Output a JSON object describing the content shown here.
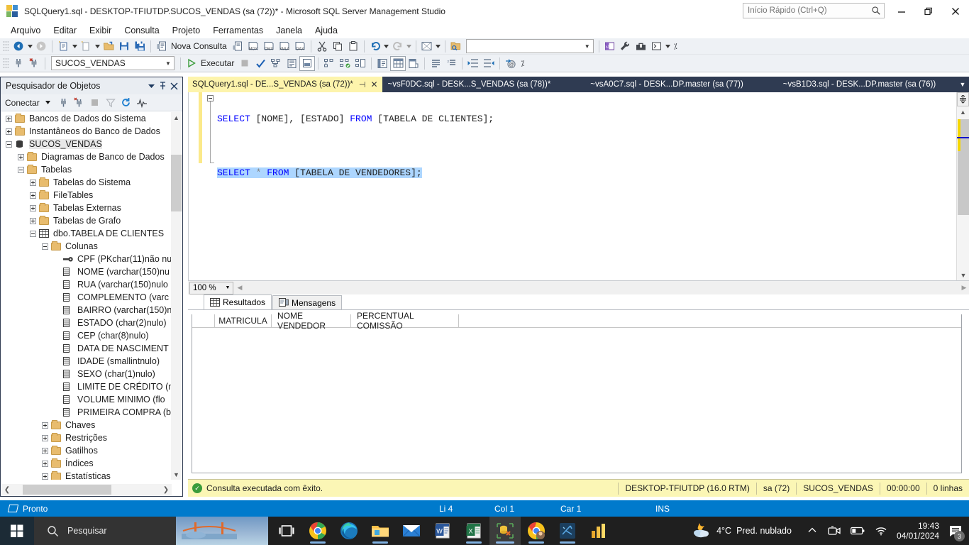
{
  "window": {
    "title": "SQLQuery1.sql - DESKTOP-TFIUTDP.SUCOS_VENDAS (sa (72))* - Microsoft SQL Server Management Studio",
    "app_icon": "ssms-icon",
    "quick_launch_placeholder": "Início Rápido (Ctrl+Q)",
    "minimize_label": "Minimizar",
    "restore_label": "Restaurar",
    "close_label": "Fechar"
  },
  "menu": {
    "items": [
      {
        "label": "Arquivo"
      },
      {
        "label": "Editar"
      },
      {
        "label": "Exibir"
      },
      {
        "label": "Consulta"
      },
      {
        "label": "Projeto"
      },
      {
        "label": "Ferramentas"
      },
      {
        "label": "Janela"
      },
      {
        "label": "Ajuda"
      }
    ]
  },
  "toolbar_main": {
    "new_query_label": "Nova Consulta",
    "buttons": [
      {
        "name": "navigate-backward-icon"
      },
      {
        "name": "navigate-forward-icon"
      },
      {
        "name": "new-project-icon"
      },
      {
        "name": "new-item-icon"
      },
      {
        "name": "open-file-icon"
      },
      {
        "name": "save-icon"
      },
      {
        "name": "save-all-icon"
      },
      {
        "name": "new-query-icon"
      },
      {
        "name": "new-query-with-connection-icon"
      },
      {
        "name": "new-mdx-query-icon"
      },
      {
        "name": "new-dmx-query-icon"
      },
      {
        "name": "new-xmla-query-icon"
      },
      {
        "name": "new-dax-query-icon"
      },
      {
        "name": "cut-icon"
      },
      {
        "name": "copy-icon"
      },
      {
        "name": "paste-icon"
      },
      {
        "name": "undo-icon"
      },
      {
        "name": "redo-icon"
      },
      {
        "name": "activity-monitor-icon"
      },
      {
        "name": "find-in-files-icon"
      },
      {
        "name": "solution-explorer-icon"
      },
      {
        "name": "properties-window-icon"
      },
      {
        "name": "toolbox-icon"
      },
      {
        "name": "powershell-icon"
      }
    ],
    "find_placeholder": ""
  },
  "toolbar_query": {
    "database": "SUCOS_VENDAS",
    "execute_label": "Executar",
    "buttons": [
      {
        "name": "connect-icon"
      },
      {
        "name": "disconnect-icon"
      },
      {
        "name": "execute-icon"
      },
      {
        "name": "stop-icon"
      },
      {
        "name": "parse-icon"
      },
      {
        "name": "display-estimated-plan-icon"
      },
      {
        "name": "query-options-icon"
      },
      {
        "name": "intellisense-enabled-icon"
      },
      {
        "name": "include-actual-plan-icon"
      },
      {
        "name": "include-live-stats-icon"
      },
      {
        "name": "include-client-stats-icon"
      },
      {
        "name": "results-to-text-icon"
      },
      {
        "name": "results-to-grid-icon"
      },
      {
        "name": "results-to-file-icon"
      },
      {
        "name": "comment-lines-icon"
      },
      {
        "name": "uncomment-lines-icon"
      },
      {
        "name": "decrease-indent-icon"
      },
      {
        "name": "increase-indent-icon"
      },
      {
        "name": "specify-values-for-template-parameters-icon"
      }
    ]
  },
  "object_explorer": {
    "title": "Pesquisador de Objetos",
    "connect_label": "Conectar",
    "toolbar_buttons": [
      {
        "name": "connect-icon"
      },
      {
        "name": "disconnect-icon"
      },
      {
        "name": "stop-icon"
      },
      {
        "name": "filter-icon"
      },
      {
        "name": "refresh-icon"
      },
      {
        "name": "activity-monitor-icon"
      }
    ],
    "tree": [
      {
        "label": "Bancos de Dados do Sistema",
        "indent": 0,
        "expander": "plus",
        "icon": "folder-icon",
        "selected": false
      },
      {
        "label": "Instantâneos do Banco de Dados",
        "indent": 0,
        "expander": "plus",
        "icon": "folder-icon",
        "selected": false
      },
      {
        "label": "SUCOS_VENDAS",
        "indent": 0,
        "expander": "minus",
        "icon": "database-icon",
        "selected": true
      },
      {
        "label": "Diagramas de Banco de Dados",
        "indent": 1,
        "expander": "plus",
        "icon": "folder-icon",
        "selected": false
      },
      {
        "label": "Tabelas",
        "indent": 1,
        "expander": "minus",
        "icon": "folder-icon",
        "selected": false
      },
      {
        "label": "Tabelas do Sistema",
        "indent": 2,
        "expander": "plus",
        "icon": "folder-icon",
        "selected": false
      },
      {
        "label": "FileTables",
        "indent": 2,
        "expander": "plus",
        "icon": "folder-icon",
        "selected": false
      },
      {
        "label": "Tabelas Externas",
        "indent": 2,
        "expander": "plus",
        "icon": "folder-icon",
        "selected": false
      },
      {
        "label": "Tabelas de Grafo",
        "indent": 2,
        "expander": "plus",
        "icon": "folder-icon",
        "selected": false
      },
      {
        "label": "dbo.TABELA DE CLIENTES",
        "indent": 2,
        "expander": "minus",
        "icon": "table-icon",
        "selected": false
      },
      {
        "label": "Colunas",
        "indent": 3,
        "expander": "minus",
        "icon": "folder-icon",
        "selected": false
      },
      {
        "label": "CPF (PKchar(11)não nu",
        "indent": 4,
        "expander": "none",
        "icon": "primary-key-icon",
        "selected": false
      },
      {
        "label": "NOME (varchar(150)nu",
        "indent": 4,
        "expander": "none",
        "icon": "column-icon",
        "selected": false
      },
      {
        "label": "RUA (varchar(150)nulo",
        "indent": 4,
        "expander": "none",
        "icon": "column-icon",
        "selected": false
      },
      {
        "label": "COMPLEMENTO (varc",
        "indent": 4,
        "expander": "none",
        "icon": "column-icon",
        "selected": false
      },
      {
        "label": "BAIRRO (varchar(150)n",
        "indent": 4,
        "expander": "none",
        "icon": "column-icon",
        "selected": false
      },
      {
        "label": "ESTADO (char(2)nulo)",
        "indent": 4,
        "expander": "none",
        "icon": "column-icon",
        "selected": false
      },
      {
        "label": "CEP (char(8)nulo)",
        "indent": 4,
        "expander": "none",
        "icon": "column-icon",
        "selected": false
      },
      {
        "label": "DATA DE NASCIMENT",
        "indent": 4,
        "expander": "none",
        "icon": "column-icon",
        "selected": false
      },
      {
        "label": "IDADE (smallintnulo)",
        "indent": 4,
        "expander": "none",
        "icon": "column-icon",
        "selected": false
      },
      {
        "label": "SEXO (char(1)nulo)",
        "indent": 4,
        "expander": "none",
        "icon": "column-icon",
        "selected": false
      },
      {
        "label": "LIMITE DE CRÉDITO (m",
        "indent": 4,
        "expander": "none",
        "icon": "column-icon",
        "selected": false
      },
      {
        "label": "VOLUME MINIMO (flo",
        "indent": 4,
        "expander": "none",
        "icon": "column-icon",
        "selected": false
      },
      {
        "label": "PRIMEIRA COMPRA (b",
        "indent": 4,
        "expander": "none",
        "icon": "column-icon",
        "selected": false
      },
      {
        "label": "Chaves",
        "indent": 3,
        "expander": "plus",
        "icon": "folder-icon",
        "selected": false
      },
      {
        "label": "Restrições",
        "indent": 3,
        "expander": "plus",
        "icon": "folder-icon",
        "selected": false
      },
      {
        "label": "Gatilhos",
        "indent": 3,
        "expander": "plus",
        "icon": "folder-icon",
        "selected": false
      },
      {
        "label": "Índices",
        "indent": 3,
        "expander": "plus",
        "icon": "folder-icon",
        "selected": false
      },
      {
        "label": "Estatísticas",
        "indent": 3,
        "expander": "plus",
        "icon": "folder-icon",
        "selected": false
      }
    ]
  },
  "editor_tabs": [
    {
      "label": "SQLQuery1.sql - DE...S_VENDAS (sa (72))*",
      "active": true
    },
    {
      "label": "~vsF0DC.sql - DESK...S_VENDAS (sa (78))*",
      "active": false
    },
    {
      "label": "~vsA0C7.sql - DESK...DP.master (sa (77))",
      "active": false
    },
    {
      "label": "~vsB1D3.sql - DESK...DP.master (sa (76))",
      "active": false
    }
  ],
  "editor": {
    "line1": {
      "kw_select": "SELECT",
      "cols": " [NOME], [ESTADO] ",
      "kw_from": "FROM",
      "table": " [TABELA DE CLIENTES];"
    },
    "line2": {
      "kw_select": "SELECT",
      "star": " * ",
      "kw_from": "FROM",
      "table": " [TABELA DE VENDEDORES];"
    },
    "zoom": "100 %"
  },
  "results": {
    "tabs": [
      {
        "label": "Resultados",
        "icon": "grid-icon",
        "active": true
      },
      {
        "label": "Mensagens",
        "icon": "messages-icon",
        "active": false
      }
    ],
    "columns": [
      "MATRICULA",
      "NOME VENDEDOR",
      "PERCENTUAL COMISSÃO"
    ],
    "rows": []
  },
  "query_status": {
    "message": "Consulta executada com êxito.",
    "server": "DESKTOP-TFIUTDP (16.0 RTM)",
    "user": "sa (72)",
    "database": "SUCOS_VENDAS",
    "elapsed": "00:00:00",
    "rows": "0 linhas"
  },
  "status_bar": {
    "state": "Pronto",
    "line": "Li 4",
    "col": "Col 1",
    "char": "Car 1",
    "insert_mode": "INS"
  },
  "taskbar": {
    "search_placeholder": "Pesquisar",
    "apps": [
      {
        "name": "task-view-icon"
      },
      {
        "name": "google-chrome-icon"
      },
      {
        "name": "microsoft-edge-icon"
      },
      {
        "name": "file-explorer-icon"
      },
      {
        "name": "mail-icon"
      },
      {
        "name": "word-icon"
      },
      {
        "name": "excel-icon"
      },
      {
        "name": "ssms-icon"
      },
      {
        "name": "chrome-profile-icon"
      },
      {
        "name": "azure-data-studio-icon"
      },
      {
        "name": "power-bi-icon"
      }
    ],
    "weather_temp": "4°C",
    "weather_desc": "Pred. nublado",
    "time": "19:43",
    "date": "04/01/2024",
    "notification_count": "3"
  },
  "colors": {
    "accent": "#007acc",
    "tab_active": "#fdf4ac",
    "tabstrip": "#2f3b52",
    "status_yellow": "#fbf6b5",
    "keyword": "#0000ff",
    "selection": "#add6ff"
  }
}
